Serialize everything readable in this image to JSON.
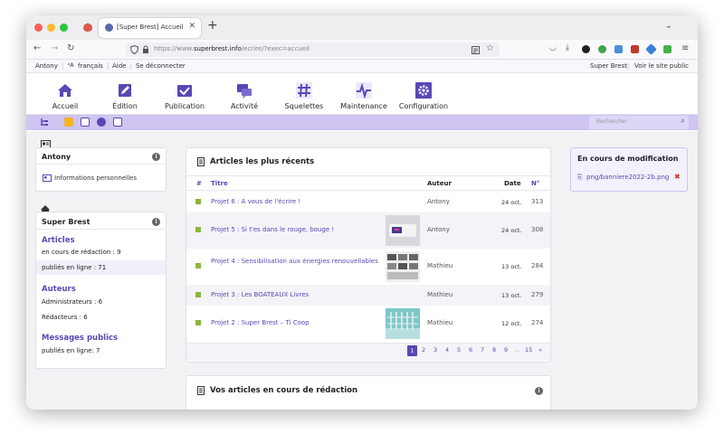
{
  "browser": {
    "tab_title": "[Super Brest] Accueil",
    "url_prefix": "https://www.",
    "url_domain": "superbrest.info",
    "url_path": "/ecrire/?exec=accueil"
  },
  "toplinks": {
    "user": "Antony",
    "language": "français",
    "help": "Aide",
    "logout": "Se déconnecter",
    "site_name": "Super Brest",
    "view_site": "Voir le site public"
  },
  "menu": [
    {
      "label": "Accueil",
      "icon": "home-icon"
    },
    {
      "label": "Édition",
      "icon": "pencil-icon"
    },
    {
      "label": "Publication",
      "icon": "check-icon"
    },
    {
      "label": "Activité",
      "icon": "chat-icon"
    },
    {
      "label": "Squelettes",
      "icon": "hash-icon"
    },
    {
      "label": "Maintenance",
      "icon": "pulse-icon"
    },
    {
      "label": "Configuration",
      "icon": "gear-icon"
    }
  ],
  "search": {
    "placeholder": "Rechercher"
  },
  "user_box": {
    "name": "Antony",
    "link": "Informations personnelles"
  },
  "site_box": {
    "title": "Super Brest",
    "articles_heading": "Articles",
    "articles_draft": "en cours de rédaction : 9",
    "articles_online": "publiés en ligne : 71",
    "authors_heading": "Auteurs",
    "admins": "Administrateurs : 6",
    "editors": "Rédacteurs : 6",
    "messages_heading": "Messages publics",
    "messages_online": "publiés en ligne: 7"
  },
  "recent": {
    "title": "Articles les plus récents",
    "headers": {
      "num": "#",
      "title": "Titre",
      "author": "Auteur",
      "date": "Date",
      "no": "N°"
    },
    "rows": [
      {
        "title": "Projet 6 : A vous de l'écrire !",
        "author": "Antony",
        "date": "24 oct.",
        "num": "313",
        "thumb": ""
      },
      {
        "title": "Projet 5 : Si t'es dans le rouge, bouge !",
        "author": "Antony",
        "date": "24 oct.",
        "num": "308",
        "thumb": "device"
      },
      {
        "title": "Projet 4 : Sensibilisation aux énergies renouvellables",
        "author": "Mathieu",
        "date": "13 oct.",
        "num": "284",
        "thumb": "screens"
      },
      {
        "title": "Projet 3 : Les BOATEAUX Livres",
        "author": "Mathieu",
        "date": "13 oct.",
        "num": "279",
        "thumb": ""
      },
      {
        "title": "Projet 2 : Super Brest – Ti Coop",
        "author": "Mathieu",
        "date": "12 oct.",
        "num": "274",
        "thumb": "building"
      }
    ],
    "pages": [
      "1",
      "2",
      "3",
      "4",
      "5",
      "6",
      "7",
      "8",
      "9",
      "...",
      "15",
      "»"
    ]
  },
  "drafts": {
    "title": "Vos articles en cours de rédaction"
  },
  "editing": {
    "title": "En cours de modification",
    "file": "png/banniere2022-2b.png"
  },
  "colors": {
    "accent": "#5a47b6",
    "subbar": "#cfc4f2",
    "marker": "#8db541"
  }
}
